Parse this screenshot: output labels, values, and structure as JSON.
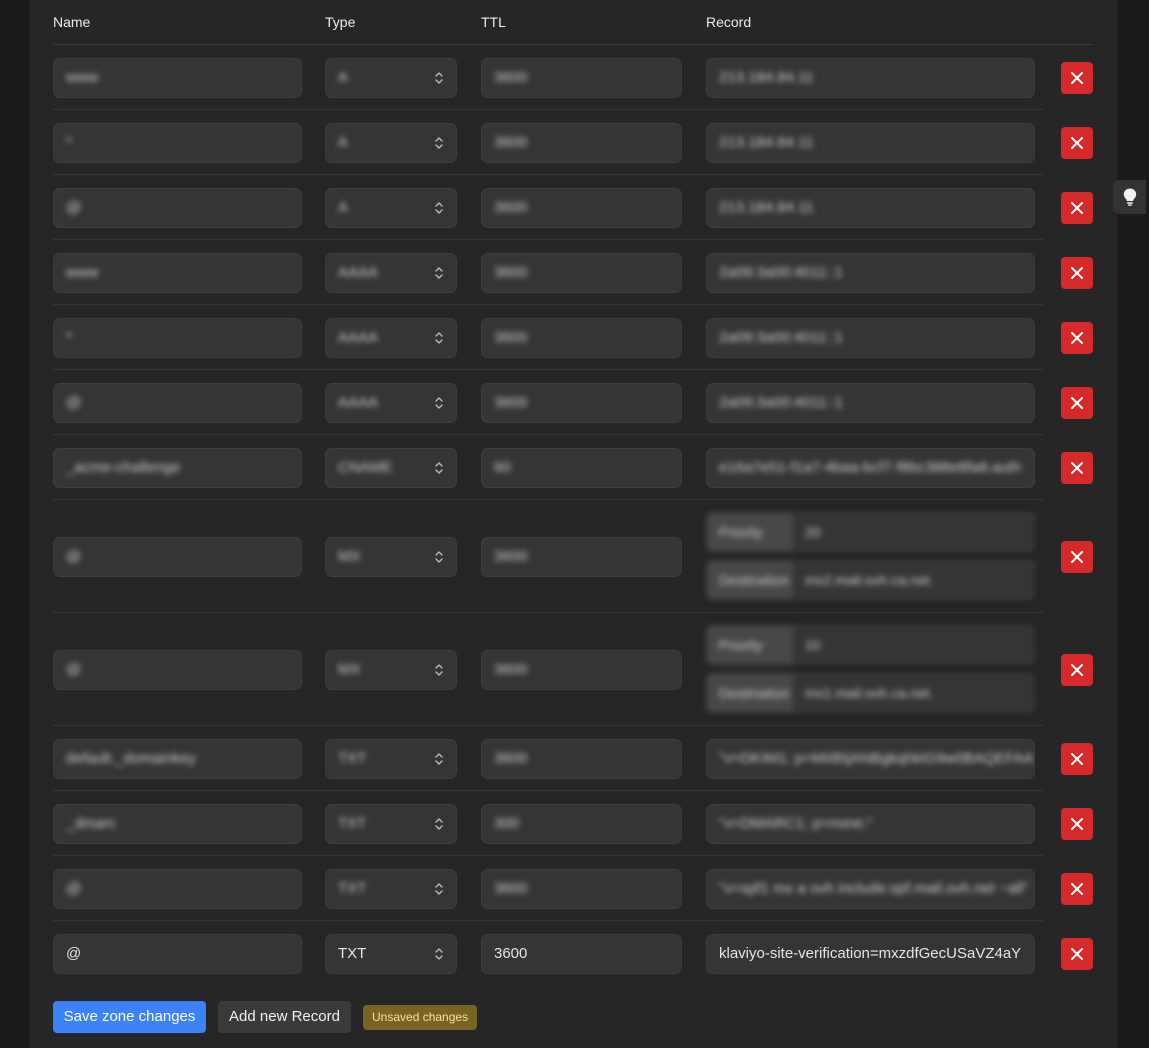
{
  "columns": {
    "name": "Name",
    "type": "Type",
    "ttl": "TTL",
    "record": "Record"
  },
  "records": [
    {
      "name": "www",
      "type": "A",
      "ttl": "3600",
      "record": "213.184.84.11",
      "blurred": true
    },
    {
      "name": "*",
      "type": "A",
      "ttl": "3600",
      "record": "213.184.84.11",
      "blurred": true
    },
    {
      "name": "@",
      "type": "A",
      "ttl": "3600",
      "record": "213.184.84.11",
      "blurred": true
    },
    {
      "name": "www",
      "type": "AAAA",
      "ttl": "3600",
      "record": "2a09:3a00:4011::1",
      "blurred": true
    },
    {
      "name": "*",
      "type": "AAAA",
      "ttl": "3600",
      "record": "2a09:3a00:4011::1",
      "blurred": true
    },
    {
      "name": "@",
      "type": "AAAA",
      "ttl": "3600",
      "record": "2a09:3a00:4011::1",
      "blurred": true
    },
    {
      "name": "_acme-challenge",
      "type": "CNAME",
      "ttl": "60",
      "record": "e16a7e51-f1a7-4baa-bcf7-f8bc388e8fa8.auth",
      "blurred": true
    },
    {
      "name": "@",
      "type": "MX",
      "ttl": "3600",
      "priority_label": "Priority",
      "priority": "20",
      "destination_label": "Destination",
      "destination": "mx2.mail.ovh.ca.net.",
      "blurred": true
    },
    {
      "name": "@",
      "type": "MX",
      "ttl": "3600",
      "priority_label": "Priority",
      "priority": "10",
      "destination_label": "Destination",
      "destination": "mx1.mail.ovh.ca.net.",
      "blurred": true
    },
    {
      "name": "default._domainkey",
      "type": "TXT",
      "ttl": "3600",
      "record": "\"v=DKIM1; p=MIIBIjANBgkqhkiG9w0BAQEFAA",
      "blurred": true
    },
    {
      "name": "_dmarc",
      "type": "TXT",
      "ttl": "300",
      "record": "\"v=DMARC1; p=none;\"",
      "blurred": true
    },
    {
      "name": "@",
      "type": "TXT",
      "ttl": "3600",
      "record": "\"v=spf1 mx a ovh include:spf.mail.ovh.net ~all\"",
      "blurred": true
    },
    {
      "name": "@",
      "type": "TXT",
      "ttl": "3600",
      "record": "klaviyo-site-verification=mxzdfGecUSaVZ4aY",
      "blurred": false
    }
  ],
  "footer": {
    "save_label": "Save zone changes",
    "add_label": "Add new Record",
    "badge": "Unsaved changes"
  },
  "colors": {
    "primary": "#3b82f6",
    "danger": "#d62a2a",
    "warning_badge": "#7a6424"
  },
  "icons": {
    "delete": "close-icon",
    "select": "chevron-updown-icon",
    "hint": "lightbulb-icon"
  }
}
